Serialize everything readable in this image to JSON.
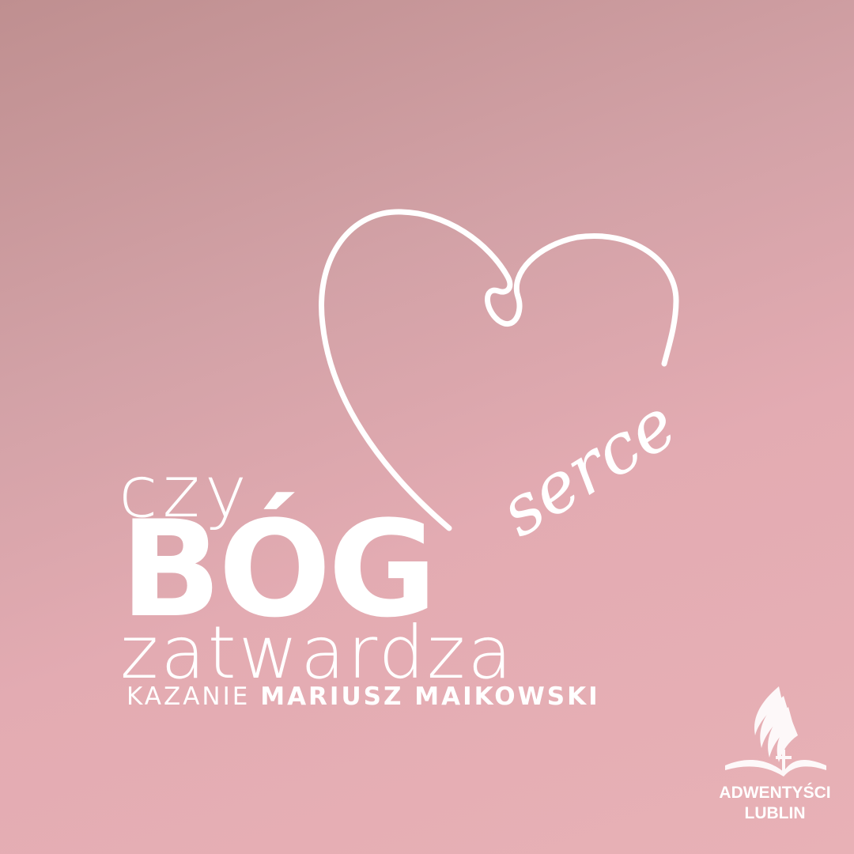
{
  "background": {
    "top_color": "#bf8f90",
    "bottom_color": "#e8b1b6"
  },
  "ornament": {
    "icon": "heart-icon",
    "script_word": "serce"
  },
  "title": {
    "line1": "czy",
    "line2": "BÓG",
    "line3": "zatwardza"
  },
  "sermon": {
    "label": "KAZANIE",
    "preacher": "MARIUSZ MAIKOWSKI"
  },
  "logo": {
    "icon": "adventist-flame-icon",
    "line1": "ADWENTYŚCI",
    "line2": "LUBLIN"
  }
}
